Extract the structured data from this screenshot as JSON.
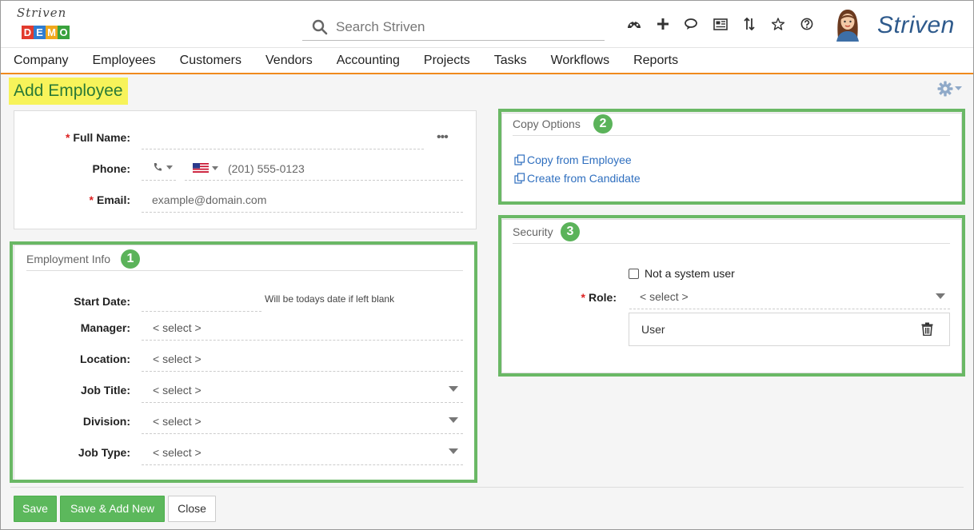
{
  "logo": {
    "script": "Striven",
    "demo_letters": [
      "D",
      "E",
      "M",
      "O"
    ],
    "demo_colors": [
      "#e23b2e",
      "#2f7dd1",
      "#f1a81b",
      "#3aa23d"
    ]
  },
  "search": {
    "placeholder": "Search Striven"
  },
  "header_icons": [
    "dashboard-icon",
    "plus-icon",
    "chat-icon",
    "news-icon",
    "sort-icon",
    "star-icon",
    "help-icon"
  ],
  "brand": "Striven",
  "nav": [
    "Company",
    "Employees",
    "Customers",
    "Vendors",
    "Accounting",
    "Projects",
    "Tasks",
    "Workflows",
    "Reports"
  ],
  "page": {
    "title": "Add Employee"
  },
  "contact": {
    "full_name_label": "Full Name:",
    "phone_label": "Phone:",
    "phone_placeholder": "(201) 555-0123",
    "email_label": "Email:",
    "email_placeholder": "example@domain.com"
  },
  "employment": {
    "title": "Employment Info",
    "badge": "1",
    "start_date_label": "Start Date:",
    "start_date_hint": "Will be todays date if left blank",
    "manager_label": "Manager:",
    "location_label": "Location:",
    "job_title_label": "Job Title:",
    "division_label": "Division:",
    "job_type_label": "Job Type:",
    "select_placeholder": "< select >"
  },
  "copy_options": {
    "title": "Copy Options",
    "badge": "2",
    "copy_from_employee": "Copy from Employee",
    "create_from_candidate": "Create from Candidate"
  },
  "security": {
    "title": "Security",
    "badge": "3",
    "not_system_user": "Not a system user",
    "not_system_user_checked": false,
    "role_label": "Role:",
    "role_placeholder": "< select >",
    "role_value": "User"
  },
  "buttons": {
    "save": "Save",
    "save_add_new": "Save & Add New",
    "close": "Close"
  },
  "colors": {
    "accent_green": "#5cb85c",
    "highlight_box": "#6ab865",
    "title_highlight": "#f7f35a",
    "nav_underline": "#f08a1d",
    "link_blue": "#2f6fbf",
    "brand_blue": "#2e5a8c"
  }
}
